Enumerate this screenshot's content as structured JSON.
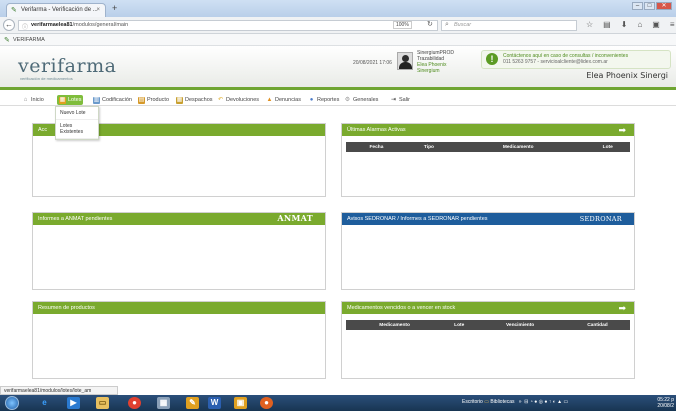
{
  "browser": {
    "tab_title": "Verifarma - Verificación de ...",
    "tab_close": "×",
    "new_tab": "+",
    "url_host": "verifarmaelea81",
    "url_path": "/modulos/general/main",
    "zoom": "100%",
    "search_placeholder": "Buscar",
    "bookmark": "VERIFARMA",
    "status_text": "verifarmaelea81/modulos/lotes/lote_am"
  },
  "header": {
    "logo_text": "verifarma",
    "logo_tagline": "verificación de medicamentos",
    "datetime": "20/08/2021 17:06",
    "user_lines": [
      "SinergiumPROD",
      "Trazabilidad",
      "Elea Phoenix",
      "Sinergium"
    ],
    "alert_line1": "Contáctenos aquí en caso de consultas / inconvenientes",
    "alert_line2": "011 5263 9757 - servicioalcliente@lidex.com.ar",
    "company": "Elea Phoenix Sinergi"
  },
  "nav": {
    "items": [
      {
        "label": "Inicio",
        "icon": "home-icon",
        "color": "#888"
      },
      {
        "label": "Lotes",
        "icon": "lotes-icon",
        "color": "#e0a020"
      },
      {
        "label": "Codificación",
        "icon": "codificacion-icon",
        "color": "#6a9acb"
      },
      {
        "label": "Producto",
        "icon": "producto-icon",
        "color": "#d69a2a"
      },
      {
        "label": "Despachos",
        "icon": "despachos-icon",
        "color": "#c8a030"
      },
      {
        "label": "Devoluciones",
        "icon": "devoluciones-icon",
        "color": "#e0b030"
      },
      {
        "label": "Denuncias",
        "icon": "warning-icon",
        "color": "#e09020"
      },
      {
        "label": "Reportes",
        "icon": "reportes-icon",
        "color": "#4a7ac8"
      },
      {
        "label": "Generales",
        "icon": "gear-icon",
        "color": "#999"
      },
      {
        "label": "Salir",
        "icon": "exit-icon",
        "color": "#444"
      }
    ],
    "dropdown": [
      "Nuevo Lote",
      "Lotes Existentes"
    ]
  },
  "panels": {
    "p1": {
      "title": "Acc"
    },
    "p2": {
      "title": "Últimas Alarmas Activas",
      "columns": [
        "Fecha",
        "Tipo",
        "Medicamento",
        "Lote"
      ]
    },
    "p3": {
      "title": "Informes a ANMAT pendientes",
      "badge": "ANMAT"
    },
    "p4": {
      "title": "Avisos SEDRONAR / Informes a SEDRONAR pendientes",
      "badge": "SEDRONAR"
    },
    "p5": {
      "title": "Resumen de productos"
    },
    "p6": {
      "title": "Medicamentos vencidos o a vencer en stock",
      "columns": [
        "Medicamento",
        "Lote",
        "Vencimiento",
        "Cantidad"
      ]
    }
  },
  "taskbar": {
    "tray_desktop": "Escritorio",
    "tray_libraries": "Bibliotecas",
    "time": "05:22 p",
    "date": "20/08/2"
  }
}
